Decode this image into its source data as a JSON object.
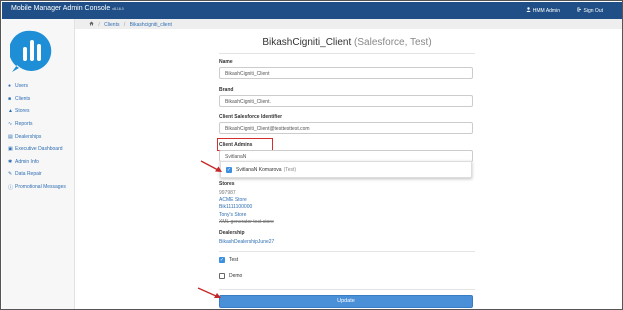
{
  "app": {
    "title": "Mobile Manager Admin Console",
    "version": "v8.16.0",
    "user_label": "HMM Admin",
    "signout_label": "Sign Out"
  },
  "breadcrumb": {
    "home_icon": "home-icon",
    "items": [
      "Clients",
      "Bikashcigniti_client"
    ]
  },
  "sidebar": {
    "items": [
      {
        "label": "Users",
        "icon": "users-icon"
      },
      {
        "label": "Clients",
        "icon": "clients-icon"
      },
      {
        "label": "Stores",
        "icon": "stores-icon"
      },
      {
        "label": "Reports",
        "icon": "reports-icon"
      },
      {
        "label": "Dealerships",
        "icon": "dealerships-icon"
      },
      {
        "label": "Executive Dashboard",
        "icon": "dashboard-icon"
      },
      {
        "label": "Admin Info",
        "icon": "admin-info-icon"
      },
      {
        "label": "Data Repair",
        "icon": "wrench-icon"
      },
      {
        "label": "Promotional Messages",
        "icon": "info-icon"
      }
    ]
  },
  "page": {
    "title": "BikashCigniti_Client",
    "subtitle": "(Salesforce, Test)"
  },
  "form": {
    "name": {
      "label": "Name",
      "value": "BikashCigniti_Client"
    },
    "brand": {
      "label": "Brand",
      "value": "BikashCigniti_Client."
    },
    "sf_id": {
      "label": "Client Salesforce Identifier",
      "value": "BikashCigniti_Client@testtesttest.com"
    },
    "admins": {
      "label": "Client Admins",
      "value": "SvitlanaN",
      "suggestion_name": "SvitlanaN Komarova",
      "suggestion_tag": "(Test)",
      "suggestion_checked": true
    },
    "stores": {
      "label": "Stores",
      "items": [
        {
          "text": "997987",
          "style": "muted"
        },
        {
          "text": "ACME Store",
          "style": "link"
        },
        {
          "text": "Bik1111100000",
          "style": "link"
        },
        {
          "text": "Tony's Store",
          "style": "link"
        },
        {
          "text": "XML generator test store",
          "style": "strike"
        }
      ]
    },
    "dealership": {
      "label": "Dealership",
      "value": "BikashDealershipJune27"
    },
    "test": {
      "label": "Test",
      "checked": true
    },
    "demo": {
      "label": "Demo",
      "checked": false
    },
    "update_label": "Update"
  },
  "colors": {
    "topbar": "#1f4f86",
    "accent": "#4a90d9",
    "link": "#2f6fb3",
    "highlight": "#d32f2f"
  }
}
